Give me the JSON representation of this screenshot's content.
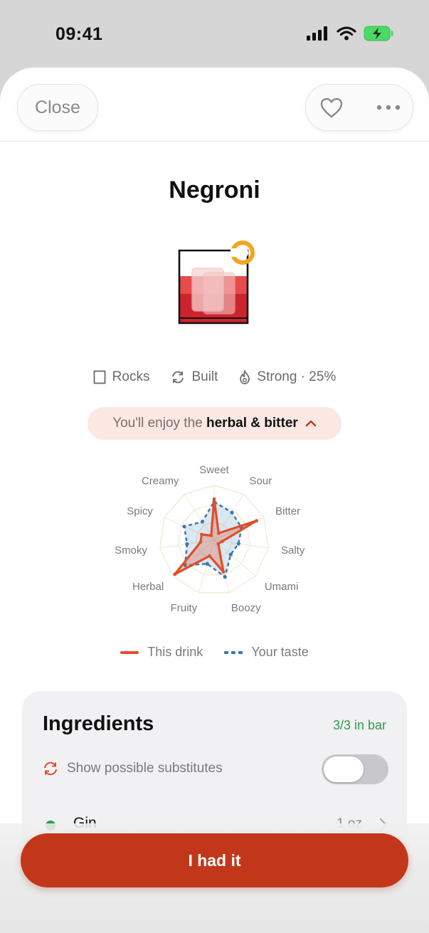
{
  "status_bar": {
    "time": "09:41"
  },
  "header": {
    "close_label": "Close"
  },
  "drink": {
    "name": "Negroni",
    "glass": "Rocks",
    "method": "Built",
    "strength": "Strong · 25%"
  },
  "enjoy_pill": {
    "prefix": "You'll enjoy the",
    "highlight": "herbal & bitter"
  },
  "chart_data": {
    "type": "radar",
    "axes": [
      "Sweet",
      "Sour",
      "Bitter",
      "Salty",
      "Umami",
      "Boozy",
      "Fruity",
      "Herbal",
      "Smoky",
      "Spicy",
      "Creamy"
    ],
    "series": [
      {
        "name": "This drink",
        "values": [
          0.75,
          0.15,
          0.85,
          0.15,
          0.1,
          0.6,
          0.3,
          0.95,
          0.25,
          0.25,
          0.1
        ],
        "color": "#e04e2c"
      },
      {
        "name": "Your taste",
        "values": [
          0.7,
          0.6,
          0.55,
          0.45,
          0.4,
          0.7,
          0.45,
          0.7,
          0.5,
          0.6,
          0.4
        ],
        "color": "#3a78b0"
      }
    ],
    "range": [
      0,
      1
    ],
    "legend_position": "bottom"
  },
  "legend": {
    "this_drink": "This drink",
    "your_taste": "Your taste"
  },
  "ingredients": {
    "title": "Ingredients",
    "count": "3/3 in bar",
    "substitutes_label": "Show possible substitutes",
    "substitutes_enabled": false,
    "items": [
      {
        "name": "Gin",
        "amount": "1 oz"
      }
    ]
  },
  "cta": {
    "label": "I had it"
  },
  "colors": {
    "accent": "#c2371a",
    "in_bar_green": "#2f9a4b",
    "pill_bg": "#fbe8e3"
  }
}
